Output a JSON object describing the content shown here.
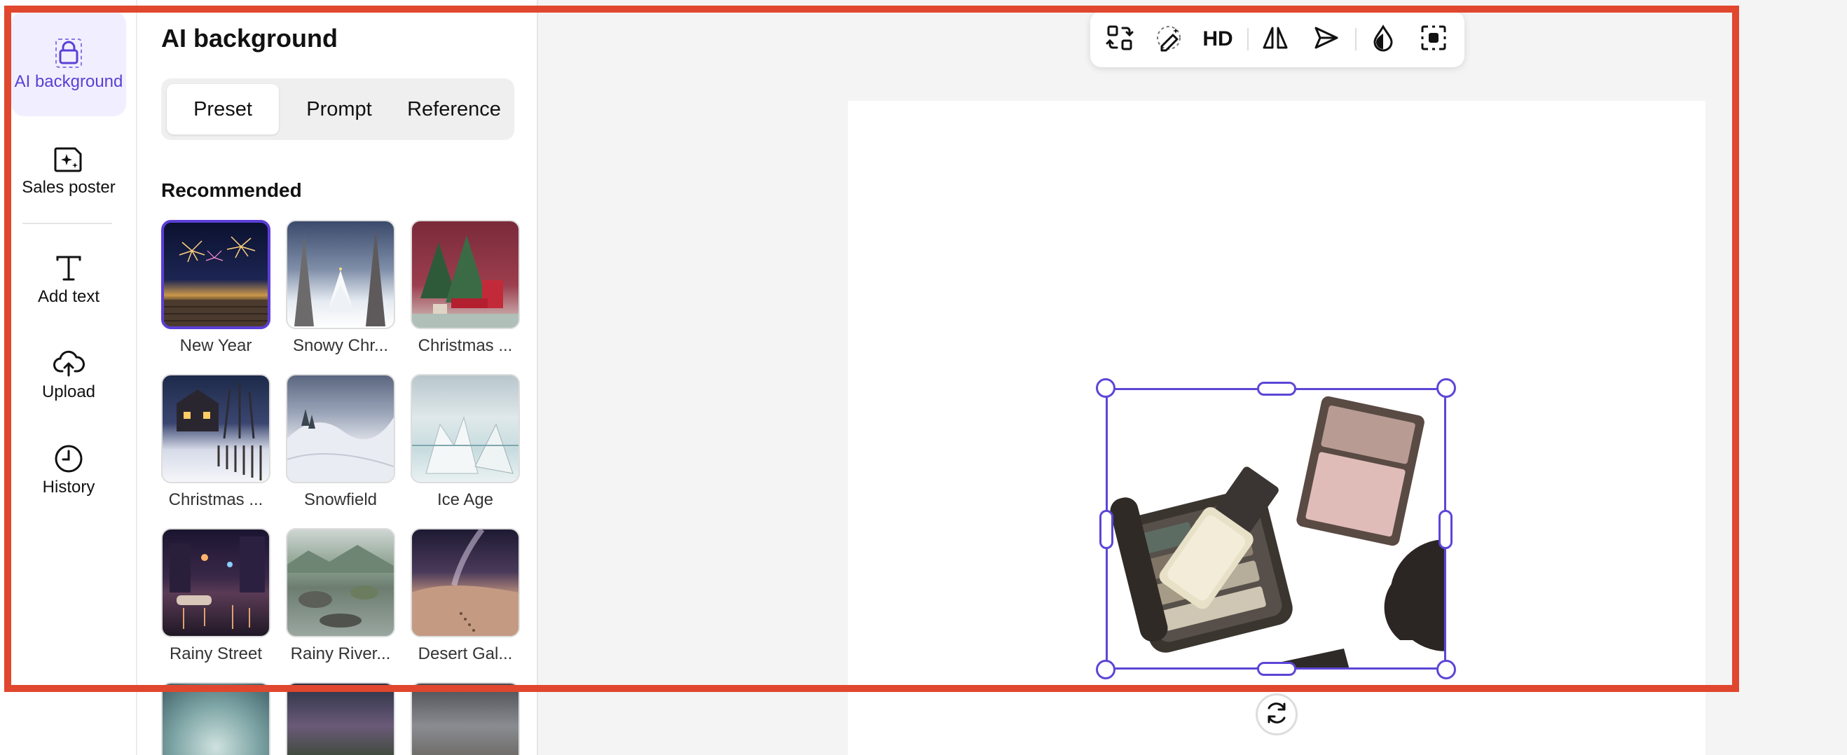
{
  "rail": {
    "items": [
      {
        "label": "AI background",
        "icon": "shopping-bag-icon",
        "active": true
      },
      {
        "label": "Sales poster",
        "icon": "image-sparkle-icon"
      },
      {
        "label": "Add text",
        "icon": "text-icon"
      },
      {
        "label": "Upload",
        "icon": "cloud-upload-icon"
      },
      {
        "label": "History",
        "icon": "clock-icon"
      }
    ]
  },
  "panel": {
    "title": "AI background",
    "tabs": [
      {
        "label": "Preset",
        "active": true
      },
      {
        "label": "Prompt"
      },
      {
        "label": "Reference"
      }
    ],
    "section_label": "Recommended",
    "presets": [
      {
        "label": "New Year",
        "selected": true
      },
      {
        "label": "Snowy Chr..."
      },
      {
        "label": "Christmas ..."
      },
      {
        "label": "Christmas ..."
      },
      {
        "label": "Snowfield"
      },
      {
        "label": "Ice Age"
      },
      {
        "label": "Rainy Street"
      },
      {
        "label": "Rainy River..."
      },
      {
        "label": "Desert Gal..."
      }
    ]
  },
  "toolbar": {
    "buttons": [
      "swap-icon",
      "magic-eraser-icon",
      "hd-icon",
      "flip-icon",
      "send-icon",
      "drop-icon",
      "focus-select-icon"
    ],
    "hd_label": "HD"
  },
  "colors": {
    "accent": "#5b3fd6",
    "frame": "#e0472e"
  }
}
